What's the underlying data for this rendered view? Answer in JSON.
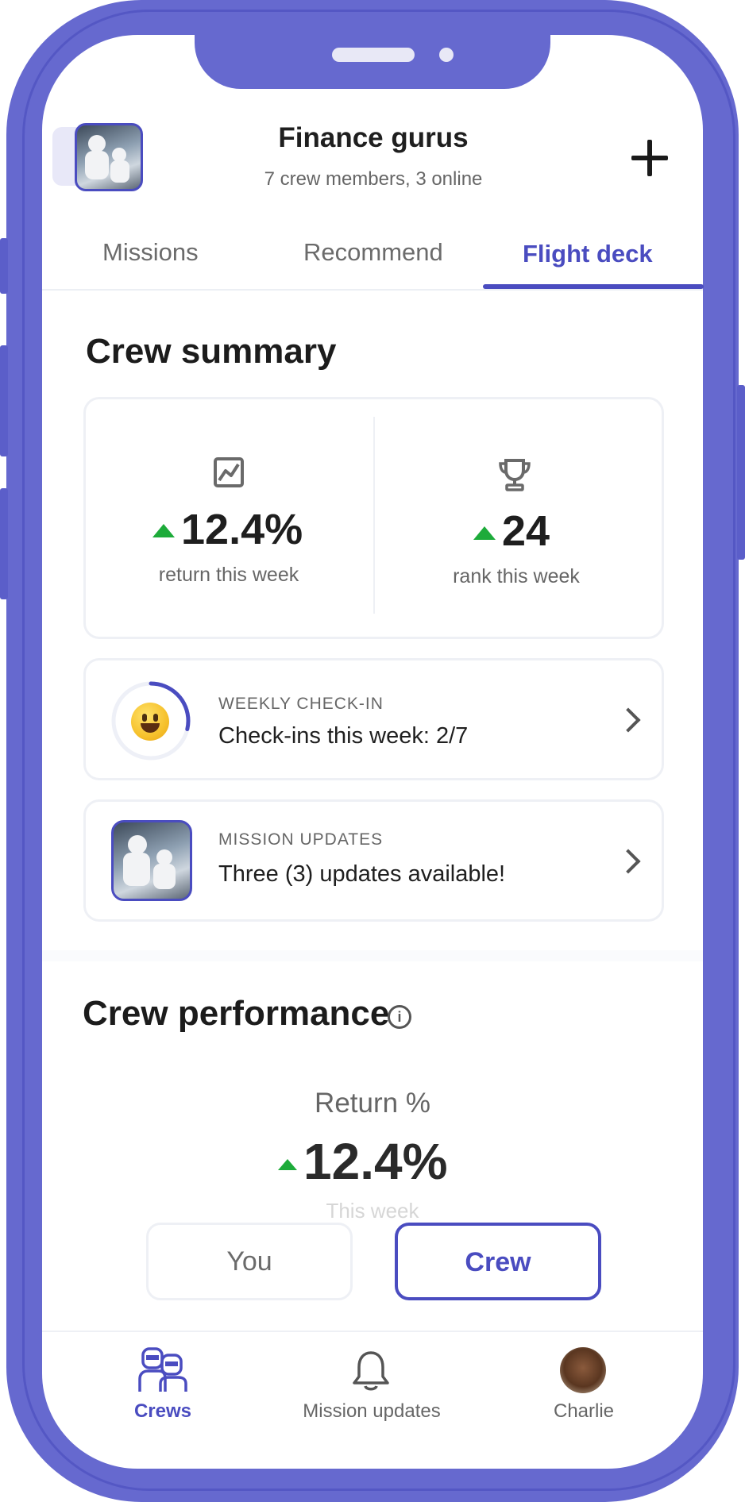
{
  "header": {
    "group_name": "Finance gurus",
    "members_status": "7 crew members, 3 online"
  },
  "tabs": [
    {
      "label": "Missions",
      "active": false
    },
    {
      "label": "Recommend",
      "active": false
    },
    {
      "label": "Flight deck",
      "active": true
    }
  ],
  "crew_summary": {
    "title": "Crew summary",
    "return": {
      "value": "12.4%",
      "label": "return this week",
      "icon": "chart-icon",
      "trend": "up"
    },
    "rank": {
      "value": "24",
      "label": "rank this week",
      "icon": "trophy-icon",
      "trend": "up"
    }
  },
  "checkin": {
    "overline": "WEEKLY CHECK-IN",
    "text": "Check-ins this week: 2/7",
    "progress": 0.2857
  },
  "mission_updates": {
    "overline": "MISSION UPDATES",
    "text": "Three (3) updates available!"
  },
  "performance": {
    "title": "Crew performance",
    "metric_label": "Return %",
    "metric_value": "12.4%",
    "period": "This week",
    "toggle": {
      "you": "You",
      "crew": "Crew",
      "selected": "Crew"
    }
  },
  "bottom_nav": [
    {
      "label": "Crews",
      "icon": "crews-icon",
      "active": true
    },
    {
      "label": "Mission updates",
      "icon": "bell-icon",
      "active": false
    },
    {
      "label": "Charlie",
      "icon": "profile-avatar",
      "active": false
    }
  ],
  "colors": {
    "accent": "#4a4cc0",
    "frame": "#6669cf",
    "positive": "#1dab3a"
  }
}
